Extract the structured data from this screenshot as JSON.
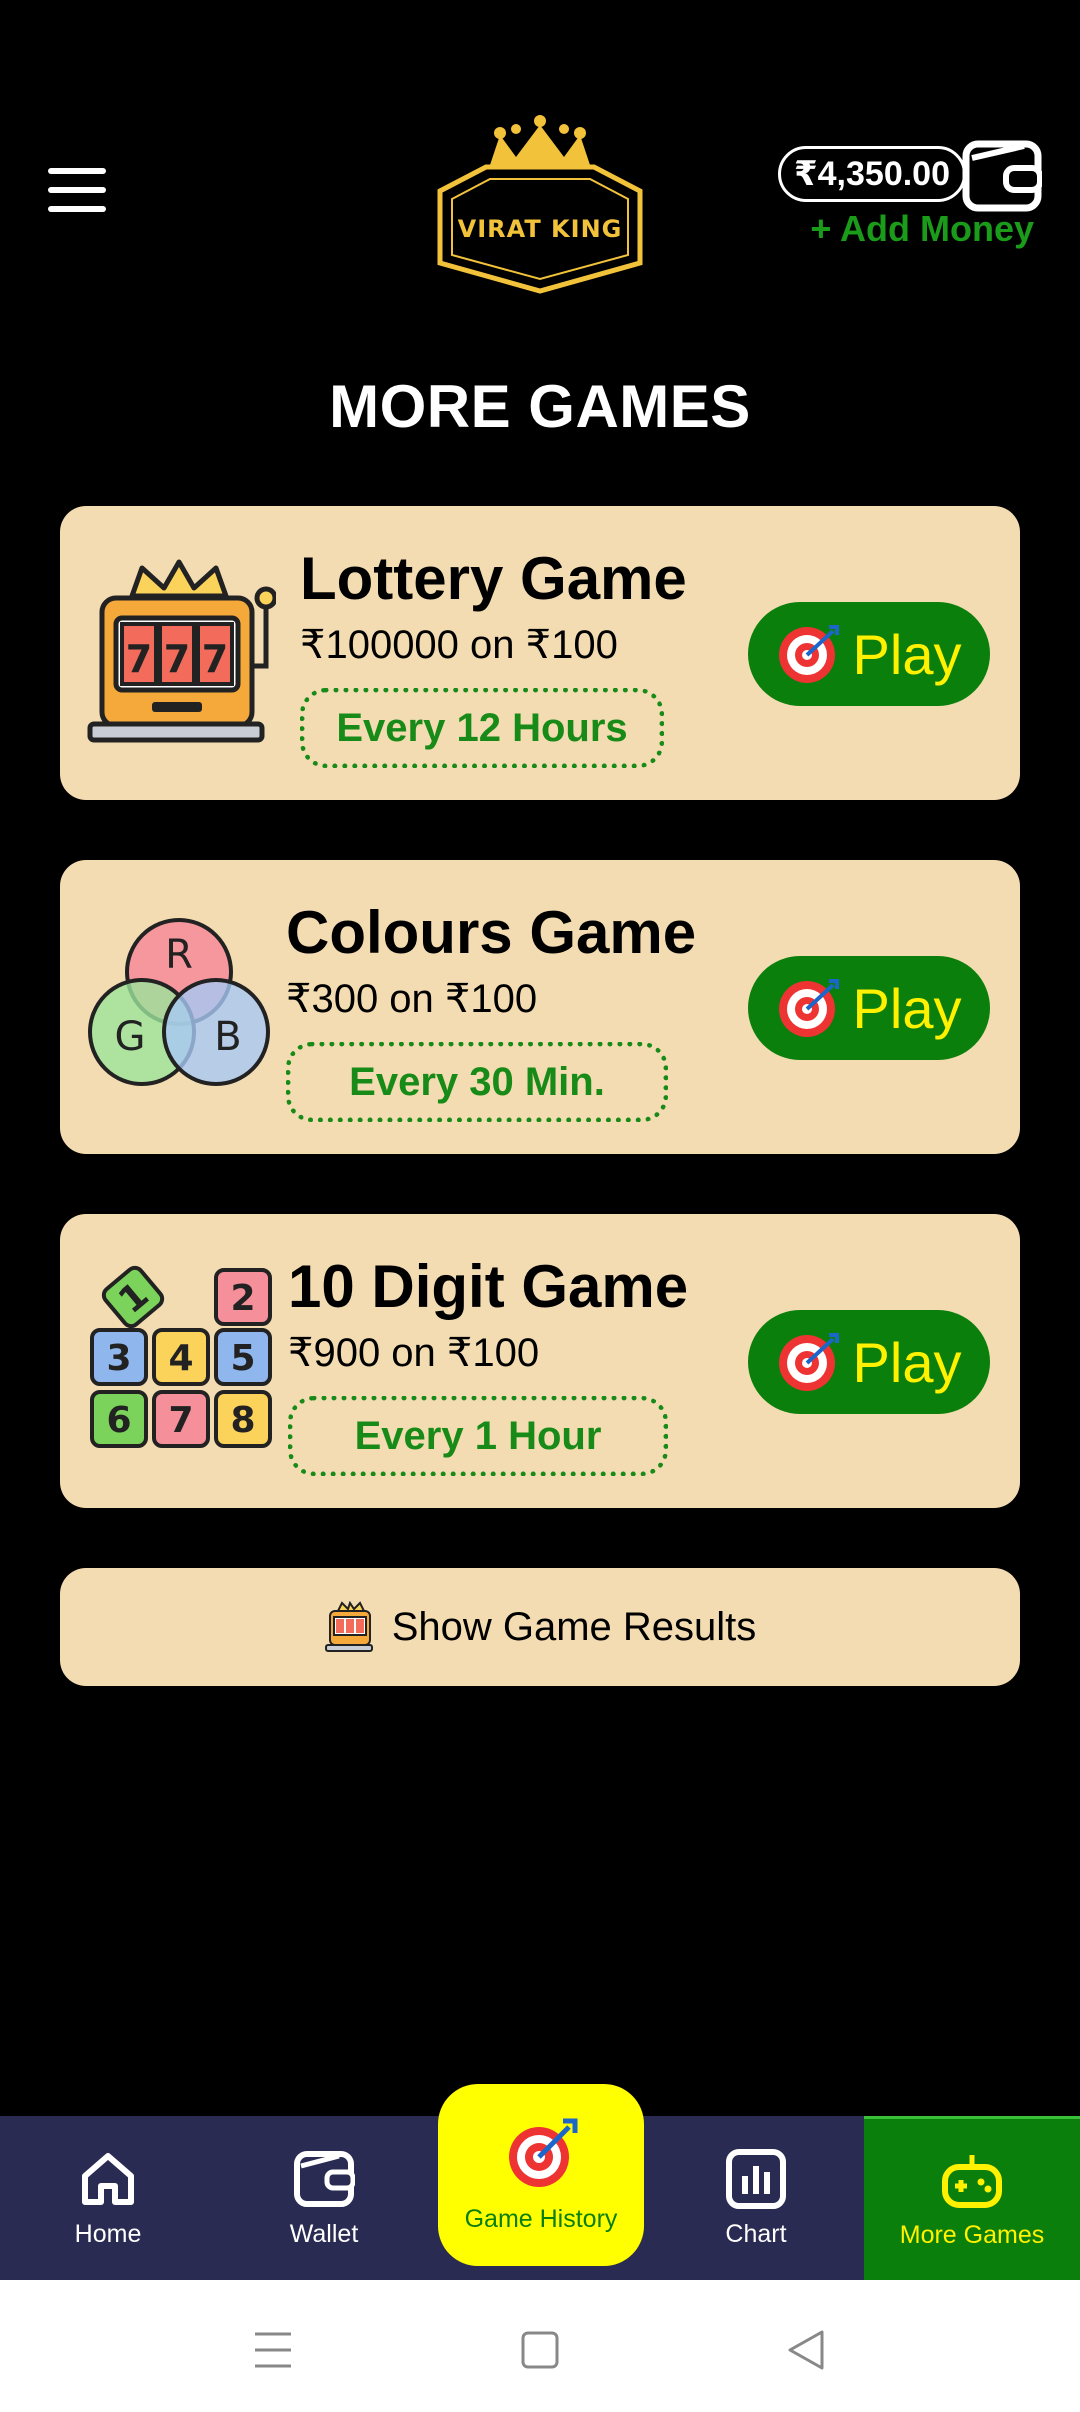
{
  "header": {
    "logo_text": "VIRAT KING",
    "balance": "₹4,350.00",
    "add_money": "+ Add Money"
  },
  "page_title": "MORE GAMES",
  "games": [
    {
      "name": "Lottery Game",
      "prize": "₹100000 on ₹100",
      "frequency": "Every 12 Hours",
      "play_label": "Play",
      "icon": "slot-machine-icon"
    },
    {
      "name": "Colours Game",
      "prize": "₹300 on ₹100",
      "frequency": "Every 30 Min.",
      "play_label": "Play",
      "icon": "rgb-circles-icon",
      "icon_letters": [
        "R",
        "G",
        "B"
      ]
    },
    {
      "name": "10 Digit Game",
      "prize": "₹900 on ₹100",
      "frequency": "Every 1 Hour",
      "play_label": "Play",
      "icon": "number-blocks-icon",
      "icon_digits": [
        "1",
        "2",
        "3",
        "4",
        "5",
        "6",
        "7",
        "8"
      ]
    }
  ],
  "results_button": "Show Game Results",
  "bottom_nav": {
    "home": "Home",
    "wallet": "Wallet",
    "game_history": "Game History",
    "chart": "Chart",
    "more_games": "More Games"
  },
  "colors": {
    "background": "#000000",
    "card": "#f3dcb1",
    "play_button": "#0b7f0b",
    "play_text": "#fff100",
    "nav_bg": "#2a2b52",
    "highlight_yellow": "#ffff00",
    "gold": "#f2c23a"
  }
}
